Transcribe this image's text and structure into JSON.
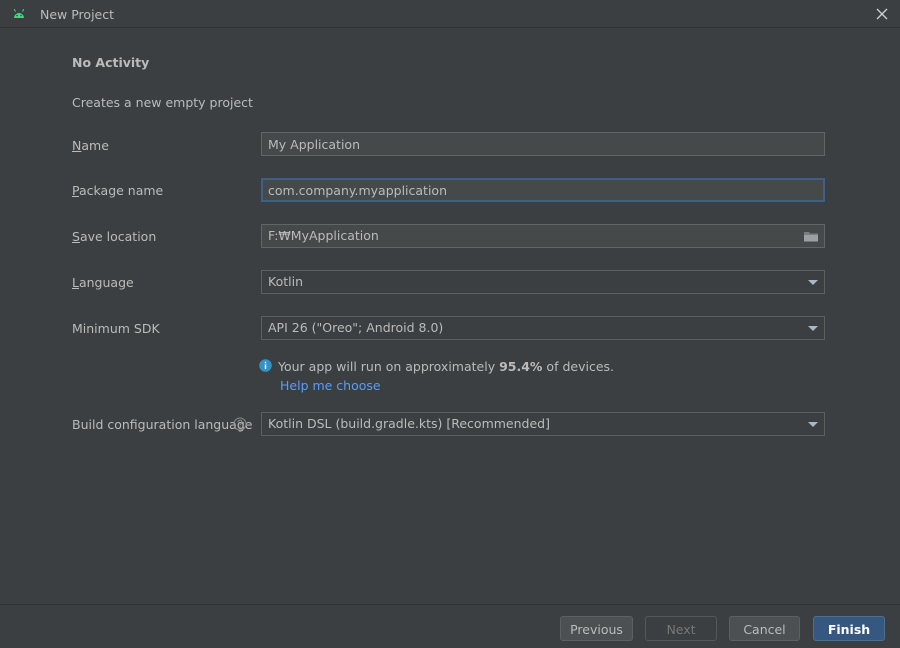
{
  "window": {
    "title": "New Project",
    "app_icon": "android-icon",
    "close_icon": "close-icon"
  },
  "template": {
    "heading": "No Activity",
    "description": "Creates a new empty project"
  },
  "form": {
    "name": {
      "label_mnemonic": "N",
      "label_rest": "ame",
      "value": "My Application"
    },
    "package": {
      "label_mnemonic": "P",
      "label_rest": "ackage name",
      "value": "com.company.myapplication"
    },
    "save_location": {
      "label_mnemonic": "S",
      "label_rest": "ave location",
      "value": "F:₩MyApplication",
      "icon": "folder-icon"
    },
    "language": {
      "label_mnemonic": "L",
      "label_rest": "anguage",
      "value": "Kotlin"
    },
    "min_sdk": {
      "label": "Minimum SDK",
      "value": "API 26 (\"Oreo\"; Android 8.0)"
    },
    "sdk_info": {
      "icon": "info-icon",
      "text_before": "Your app will run on approximately ",
      "percent": "95.4%",
      "text_after": " of devices.",
      "help_link": "Help me choose"
    },
    "build_config": {
      "label": "Build configuration language",
      "help_icon": "question-icon",
      "value": "Kotlin DSL (build.gradle.kts) [Recommended]"
    }
  },
  "buttons": {
    "previous": "Previous",
    "next": "Next",
    "cancel": "Cancel",
    "finish": "Finish"
  },
  "colors": {
    "background": "#3c3f41",
    "link": "#589df6",
    "primary_button": "#365880",
    "focus_border": "#3d6185",
    "android_green": "#3ddc84"
  }
}
